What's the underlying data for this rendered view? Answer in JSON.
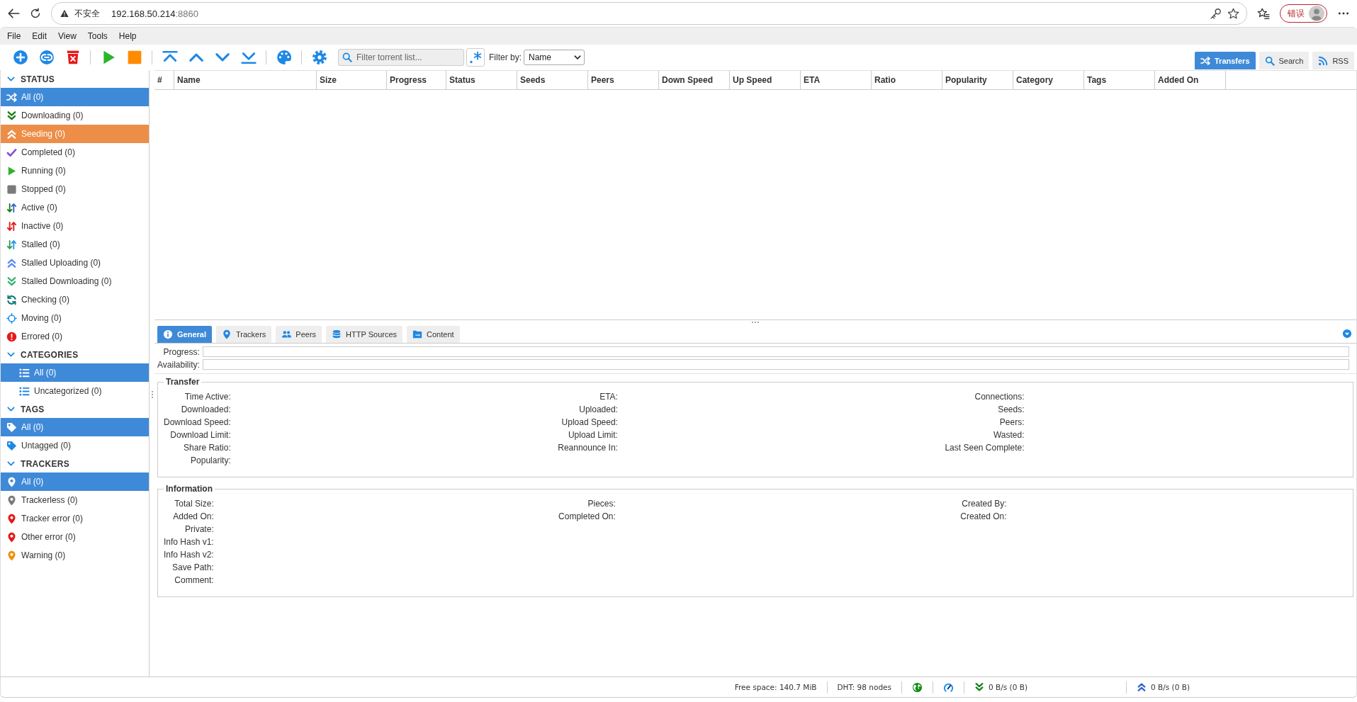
{
  "browser": {
    "security": "不安全",
    "host": "192.168.50.214",
    "port": ":8860",
    "profile_badge": "错误"
  },
  "menu": [
    "File",
    "Edit",
    "View",
    "Tools",
    "Help"
  ],
  "toolbar": {
    "filter_placeholder": "Filter torrent list...",
    "filter_by_label": "Filter by:",
    "filter_by": "Name"
  },
  "view_tabs": [
    {
      "label": "Transfers",
      "kind": "transfers",
      "selected": true
    },
    {
      "label": "Search",
      "kind": "search",
      "selected": false
    },
    {
      "label": "RSS",
      "kind": "rss",
      "selected": false
    }
  ],
  "sidebar": [
    {
      "title": "STATUS",
      "expanded": true,
      "items": [
        {
          "label": "All (0)",
          "kind": "all",
          "selected": true,
          "hovered": false
        },
        {
          "label": "Downloading (0)",
          "kind": "downloading",
          "selected": false,
          "hovered": false
        },
        {
          "label": "Seeding (0)",
          "kind": "seeding",
          "selected": false,
          "hovered": true
        },
        {
          "label": "Completed (0)",
          "kind": "completed",
          "selected": false,
          "hovered": false
        },
        {
          "label": "Running (0)",
          "kind": "running",
          "selected": false,
          "hovered": false
        },
        {
          "label": "Stopped (0)",
          "kind": "stopped",
          "selected": false,
          "hovered": false
        },
        {
          "label": "Active (0)",
          "kind": "active",
          "selected": false,
          "hovered": false
        },
        {
          "label": "Inactive (0)",
          "kind": "inactive",
          "selected": false,
          "hovered": false
        },
        {
          "label": "Stalled (0)",
          "kind": "stalled",
          "selected": false,
          "hovered": false
        },
        {
          "label": "Stalled Uploading (0)",
          "kind": "stalled-uploading",
          "selected": false,
          "hovered": false
        },
        {
          "label": "Stalled Downloading (0)",
          "kind": "stalled-downloading",
          "selected": false,
          "hovered": false
        },
        {
          "label": "Checking (0)",
          "kind": "checking",
          "selected": false,
          "hovered": false
        },
        {
          "label": "Moving (0)",
          "kind": "moving",
          "selected": false,
          "hovered": false
        },
        {
          "label": "Errored (0)",
          "kind": "errored",
          "selected": false,
          "hovered": false
        }
      ]
    },
    {
      "title": "CATEGORIES",
      "expanded": true,
      "items": [
        {
          "label": "All (0)",
          "kind": "category",
          "selected": true,
          "hovered": false
        },
        {
          "label": "Uncategorized (0)",
          "kind": "category",
          "selected": false,
          "hovered": false
        }
      ]
    },
    {
      "title": "TAGS",
      "expanded": true,
      "items": [
        {
          "label": "All (0)",
          "kind": "tag",
          "selected": true,
          "hovered": false
        },
        {
          "label": "Untagged (0)",
          "kind": "tag",
          "selected": false,
          "hovered": false
        }
      ]
    },
    {
      "title": "TRACKERS",
      "expanded": true,
      "items": [
        {
          "label": "All (0)",
          "kind": "tracker-all",
          "selected": true,
          "hovered": false
        },
        {
          "label": "Trackerless (0)",
          "kind": "trackerless",
          "selected": false,
          "hovered": false
        },
        {
          "label": "Tracker error (0)",
          "kind": "tracker-error",
          "selected": false,
          "hovered": false
        },
        {
          "label": "Other error (0)",
          "kind": "other-error",
          "selected": false,
          "hovered": false
        },
        {
          "label": "Warning (0)",
          "kind": "tracker-warning",
          "selected": false,
          "hovered": false
        }
      ]
    }
  ],
  "table": {
    "columns": [
      "#",
      "Name",
      "Size",
      "Progress",
      "Status",
      "Seeds",
      "Peers",
      "Down Speed",
      "Up Speed",
      "ETA",
      "Ratio",
      "Popularity",
      "Category",
      "Tags",
      "Added On"
    ]
  },
  "details": {
    "tabs": [
      {
        "label": "General",
        "kind": "general",
        "selected": true
      },
      {
        "label": "Trackers",
        "kind": "trackers",
        "selected": false
      },
      {
        "label": "Peers",
        "kind": "peers",
        "selected": false
      },
      {
        "label": "HTTP Sources",
        "kind": "http-sources",
        "selected": false
      },
      {
        "label": "Content",
        "kind": "content",
        "selected": false
      }
    ],
    "bars": [
      {
        "label": "Progress:",
        "level": 0
      },
      {
        "label": "Availability:",
        "level": 0
      }
    ],
    "sections": [
      {
        "title": "Transfer",
        "columns": [
          [
            "Time Active:",
            "Downloaded:",
            "Download Speed:",
            "Download Limit:",
            "Share Ratio:",
            "Popularity:"
          ],
          [
            "ETA:",
            "Uploaded:",
            "Upload Speed:",
            "Upload Limit:",
            "Reannounce In:"
          ],
          [
            "Connections:",
            "Seeds:",
            "Peers:",
            "Wasted:",
            "Last Seen Complete:"
          ]
        ]
      },
      {
        "title": "Information",
        "columns": [
          [
            "Total Size:",
            "Added On:",
            "Private:",
            "Info Hash v1:",
            "Info Hash v2:",
            "Save Path:",
            "Comment:"
          ],
          [
            "Pieces:",
            "Completed On:"
          ],
          [
            "Created By:",
            "Created On:"
          ]
        ]
      }
    ]
  },
  "status_bar": {
    "free_space": "Free space: 140.7 MiB",
    "dht": "DHT: 98 nodes",
    "download": "0 B/s (0 B)",
    "upload": "0 B/s (0 B)"
  }
}
